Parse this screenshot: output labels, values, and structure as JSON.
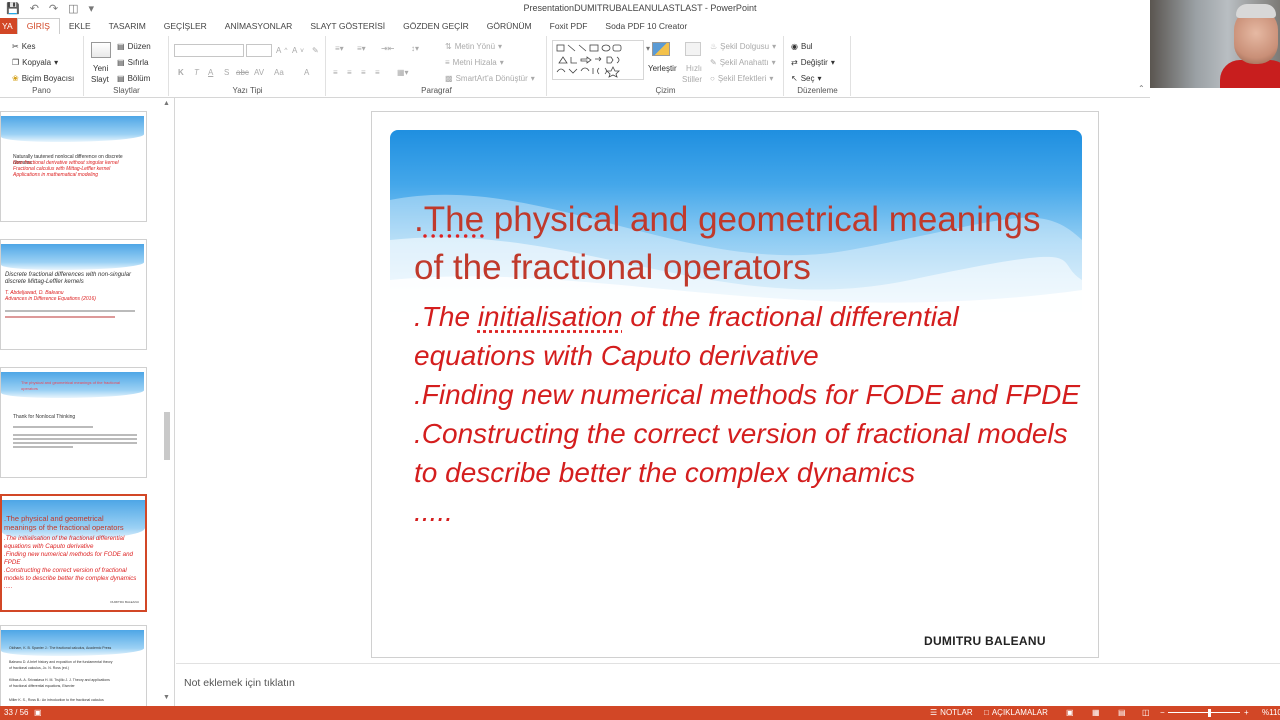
{
  "window": {
    "title": "PresentationDUMITRUBALEANULASTLAST - PowerPoint"
  },
  "tabs": [
    {
      "label": "YA",
      "key": "file"
    },
    {
      "label": "GİRİŞ",
      "key": "home"
    },
    {
      "label": "EKLE",
      "key": "insert"
    },
    {
      "label": "TASARIM",
      "key": "design"
    },
    {
      "label": "GEÇİŞLER",
      "key": "transitions"
    },
    {
      "label": "ANİMASYONLAR",
      "key": "animations"
    },
    {
      "label": "SLAYT GÖSTERİSİ",
      "key": "slideshow"
    },
    {
      "label": "GÖZDEN GEÇİR",
      "key": "review"
    },
    {
      "label": "GÖRÜNÜM",
      "key": "view"
    },
    {
      "label": "Foxit PDF",
      "key": "foxit"
    },
    {
      "label": "Soda PDF 10 Creator",
      "key": "soda"
    }
  ],
  "ribbon": {
    "clipboard": {
      "label": "Pano",
      "cut": "Kes",
      "copy": "Kopyala",
      "format_painter": "Biçim Boyacısı"
    },
    "slides": {
      "label": "Slaytlar",
      "new_slide_1": "Yeni",
      "new_slide_2": "Slayt",
      "layout": "Düzen",
      "reset": "Sıfırla",
      "section": "Bölüm"
    },
    "font": {
      "label": "Yazı Tipi",
      "bold": "K",
      "italic": "T",
      "underline": "A",
      "shadow": "S",
      "strike": "abc",
      "spacing": "AV",
      "case": "Aa"
    },
    "paragraph": {
      "label": "Paragraf",
      "text_direction": "Metin Yönü",
      "align_text": "Metni Hizala",
      "smartart": "SmartArt'a Dönüştür"
    },
    "drawing": {
      "label": "Çizim",
      "arrange": "Yerleştir",
      "quick_styles_1": "Hızlı",
      "quick_styles_2": "Stiller",
      "shape_fill": "Şekil Dolgusu",
      "shape_outline": "Şekil Anahattı",
      "shape_effects": "Şekil Efektleri"
    },
    "editing": {
      "label": "Düzenleme",
      "find": "Bul",
      "replace": "Değiştir",
      "select": "Seç"
    }
  },
  "slide": {
    "title_prefix": ".",
    "title_underlined": "The",
    "title_rest": " physical and geometrical meanings of the fractional operators",
    "body_1_prefix": ".The ",
    "body_1_underlined": "initialisation",
    "body_1_rest": " of the fractional differential equations with Caputo derivative",
    "body_2": ".Finding new numerical methods for FODE and FPDE",
    "body_3": ".Constructing the correct version of fractional models to describe better the complex dynamics",
    "body_4": ".....",
    "footer": "DUMITRU BALEANU"
  },
  "thumbnails": {
    "t1": [
      "Naturally tautened nonlocal difference on discrete domains",
      "New fractional derivative without singular kernel",
      "Fractional calculus with Mittag-Leffler kernel",
      "Applications in mathematical modeling"
    ],
    "t2": [
      "Discrete fractional differences with non-singular",
      "discrete Mittag-Leffler kernels",
      "T. Abdeljawad, D. Baleanu",
      "Advances in Difference Equations (2016)"
    ],
    "t3": [
      "The physical and geometrical meanings of the fractional operators",
      "Thank for Nonlocal Thinking"
    ],
    "t4": [
      ".The physical and geometrical",
      "meanings of the fractional operators",
      ".The initialisation of the fractional differential",
      "equations with Caputo derivative",
      ".Finding new numerical methods for FODE and",
      "FPDE",
      ".Constructing the correct version of fractional",
      "models to describe better the complex dynamics",
      "....."
    ],
    "t5": [
      "Oldham, K. B. Spanier J.: The fractional calculus, Academic Press",
      "Baleanu D. A brief history and exposition of the fundamental theory",
      "of fractional calculus, Jo. N. Ross (ed.)",
      "Kilbas A. A. Srivastava H. M. Trujillo J. J. Theory and applications",
      "of fractional differential equations, Elsevier",
      "Miller K. S., Ross B.: An introduction to the fractional calculus"
    ]
  },
  "notes": {
    "placeholder": "Not eklemek için tıklatın"
  },
  "status": {
    "slide_number": "33 / 56",
    "notes": "NOTLAR",
    "comments": "AÇIKLAMALAR",
    "zoom": "%110"
  },
  "colors": {
    "accent": "#d24726",
    "title_red": "#c0392b",
    "body_red": "#d41e1e",
    "header_blue": "#1f8fe0"
  }
}
